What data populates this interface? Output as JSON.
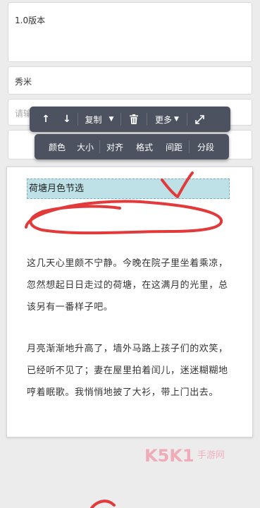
{
  "fields": {
    "version_value": "1.0版本",
    "author_value": "秀米",
    "input_placeholder_partial": "请输"
  },
  "toolbar_main": {
    "copy_label": "复制",
    "more_label": "更多"
  },
  "toolbar_format": {
    "items": [
      "颜色",
      "大小",
      "对齐",
      "格式",
      "间距",
      "分段"
    ]
  },
  "editor": {
    "title": "荷塘月色节选",
    "paragraph1": "这几天心里颇不宁静。今晚在院子里坐着乘凉，忽然想起日日走过的荷塘，在这满月的光里，总该另有一番样子吧。",
    "paragraph2": "月亮渐渐地升高了，墙外马路上孩子们的欢笑，已经听不见了；妻在屋里拍着闰儿，迷迷糊糊地哼着眠歌。我悄悄地披了大衫，带上门出去。"
  },
  "watermark": {
    "brand": "K5K1",
    "sub": "手游网"
  },
  "icons": {
    "up": "arrow-up-icon",
    "down": "arrow-down-icon",
    "trash": "trash-icon",
    "expand": "expand-icon"
  },
  "colors": {
    "toolbar_bg": "#4d5260",
    "selection_bg": "#bde1e7",
    "annotation_red": "#e23a3a"
  }
}
